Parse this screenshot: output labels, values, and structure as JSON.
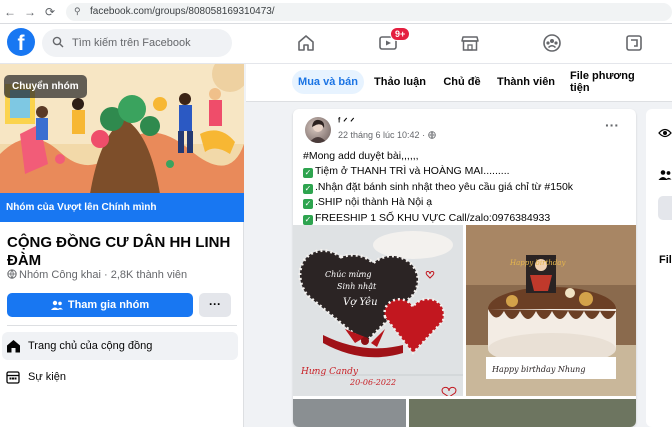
{
  "browser": {
    "url": "facebook.com/groups/808058169310473/"
  },
  "topbar": {
    "logo": "f",
    "search_placeholder": "Tìm kiếm trên Facebook",
    "video_badge": "9+"
  },
  "group": {
    "switch_label": "Chuyển nhóm",
    "cover_caption": "Nhóm của Vượt lên Chính mình",
    "name": "CỘNG ĐỒNG CƯ DÂN HH LINH ĐÀM",
    "meta": "Nhóm Công khai · 2,8K thành viên",
    "join_label": "Tham gia nhóm",
    "more_label": "···",
    "menu": [
      {
        "label": "Trang chủ của cộng đồng"
      },
      {
        "label": "Sự kiện"
      }
    ]
  },
  "tabs": [
    {
      "label": "Mua và bán",
      "active": true
    },
    {
      "label": "Thảo luận"
    },
    {
      "label": "Chủ đề"
    },
    {
      "label": "Thành viên"
    },
    {
      "label": "File phương tiện"
    }
  ],
  "post": {
    "author": "ᶠ ᐟ ᐟ",
    "time": "22 tháng 6 lúc 10:42 · ",
    "lines": [
      "#Mong add duyệt bài,,,,,,",
      "Tiệm ở  THANH TRÌ và HOÀNG MAI.........",
      ".Nhận đặt bánh sinh nhật theo yêu cầu giá chỉ từ #150k",
      ".SHIP nội thành Hà Nội ạ",
      "FREESHIP 1 SỐ KHU VỰC   Call/zalo:0976384933"
    ],
    "cake1": {
      "line1": "Chúc mừng",
      "line2": "Sinh nhật",
      "line3": "Vợ Yêu",
      "brand": "Hưng Candy",
      "date": "20-06-2022"
    },
    "cake2": {
      "topper": "Happy birthday",
      "message": "Happy birthday Nhung"
    }
  },
  "right": {
    "files_label": "File"
  },
  "colors": {
    "brand": "#1877f2",
    "page_bg": "#f0f2f5",
    "badge": "#e41e3f",
    "tab_active_bg": "#e7f3ff",
    "tab_active_text": "#1b74e4"
  }
}
